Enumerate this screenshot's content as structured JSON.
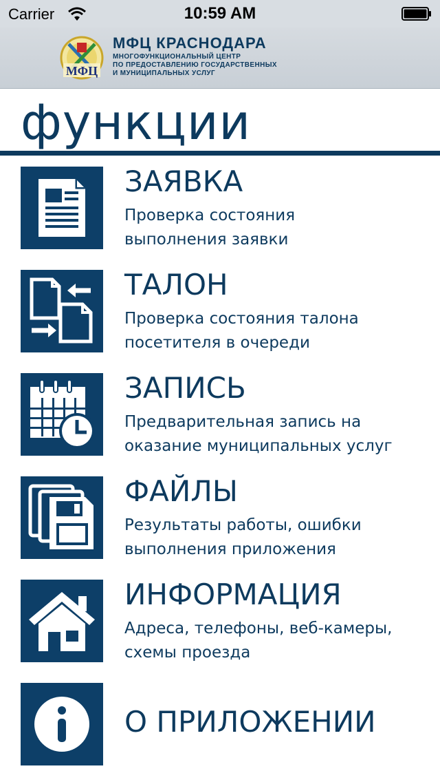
{
  "status_bar": {
    "carrier": "Carrier",
    "time": "10:59 AM",
    "wifi_icon": "wifi-icon",
    "battery_icon": "battery-icon"
  },
  "header": {
    "org_name": "МФЦ КРАСНОДАРА",
    "org_desc_lines": [
      "МНОГОФУНКЦИОНАЛЬНЫЙ ЦЕНТР",
      "ПО ПРЕДОСТАВЛЕНИЮ ГОСУДАРСТВЕННЫХ",
      "И МУНИЦИПАЛЬНЫХ УСЛУГ"
    ],
    "logo_text": "МФЦ"
  },
  "page": {
    "title": "функции"
  },
  "menu": {
    "items": [
      {
        "title": "ЗАЯВКА",
        "desc_lines": [
          "Проверка состояния",
          "выполнения заявки"
        ],
        "icon": "document-icon"
      },
      {
        "title": "ТАЛОН",
        "desc_lines": [
          "Проверка состояния талона",
          "посетителя в очереди"
        ],
        "icon": "swap-documents-icon"
      },
      {
        "title": "ЗАПИСЬ",
        "desc_lines": [
          "Предварительная запись на",
          "оказание муниципальных услуг"
        ],
        "icon": "calendar-clock-icon"
      },
      {
        "title": "ФАЙЛЫ",
        "desc_lines": [
          "Результаты работы, ошибки",
          "выполнения приложения"
        ],
        "icon": "floppy-files-icon"
      },
      {
        "title": "ИНФОРМАЦИЯ",
        "desc_lines": [
          "Адреса, телефоны, веб-камеры,",
          "схемы проезда"
        ],
        "icon": "home-icon"
      },
      {
        "title": "О ПРИЛОЖЕНИИ",
        "desc_lines": [],
        "icon": "info-icon"
      }
    ]
  },
  "colors": {
    "brand": "#0d3a5e",
    "tile": "#0d3f68",
    "header_bg": "#d6dbe0"
  }
}
